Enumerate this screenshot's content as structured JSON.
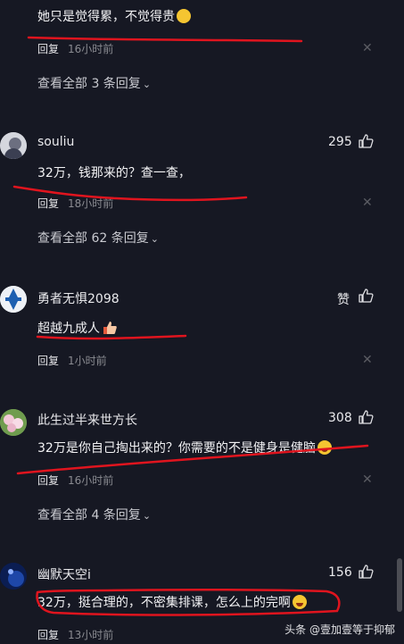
{
  "comments": [
    {
      "text": "她只是觉得累，不觉得贵",
      "reply": "回复",
      "time": "16小时前",
      "more": "查看全部 3 条回复"
    },
    {
      "user": "souliu",
      "likes": "295",
      "text": "32万，钱那来的？查一查，",
      "reply": "回复",
      "time": "18小时前",
      "more": "查看全部 62 条回复"
    },
    {
      "user": "勇者无惧2098",
      "likes": "赞",
      "text": "超越九成人",
      "reply": "回复",
      "time": "1小时前"
    },
    {
      "user": "此生过半来世方长",
      "likes": "308",
      "text": "32万是你自己掏出来的？你需要的不是健身是健脑",
      "reply": "回复",
      "time": "16小时前",
      "more": "查看全部 4 条回复"
    },
    {
      "user": "幽默天空i",
      "likes": "156",
      "text": "32万，挺合理的，不密集排课，怎么上的完啊",
      "reply": "回复",
      "time": "13小时前"
    }
  ],
  "icons": {
    "like": "thumbs-up-icon",
    "close": "close-icon",
    "chevron": "chevron-down-icon"
  },
  "watermark": "头条 @壹加壹等于抑郁",
  "colors": {
    "background": "#161823",
    "annotation": "#e0141e"
  }
}
